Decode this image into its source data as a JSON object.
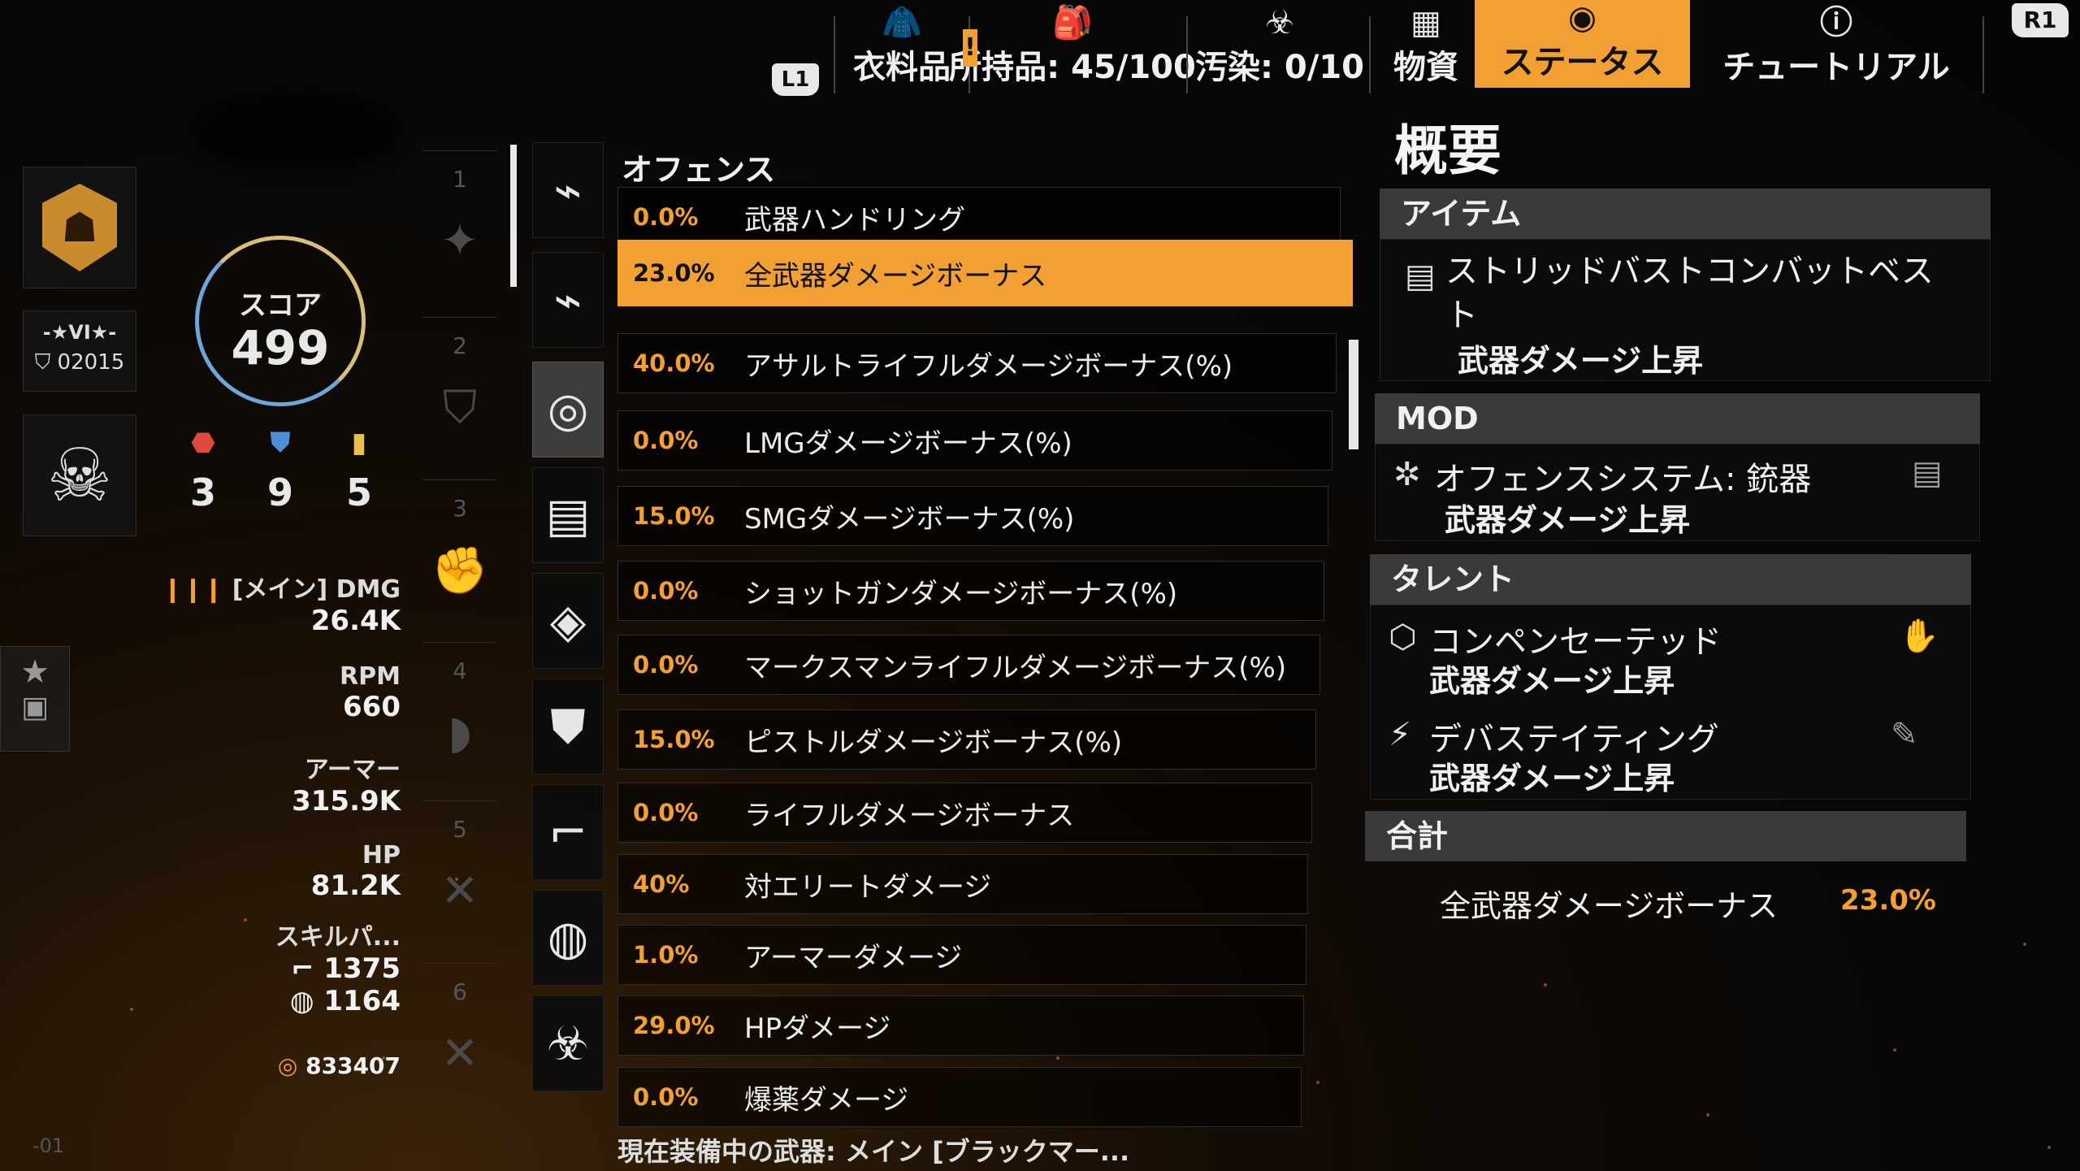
{
  "topbar": {
    "l1": "L1",
    "r1": "R1",
    "warning": "!",
    "apparel_label": "衣料品",
    "inventory_label": "所持品: 45/100",
    "contamination_label": "汚染: 0/10",
    "resources_label": "物資",
    "status_label": "ステータス",
    "tutorial_label": "チュートリアル",
    "icons": {
      "apparel": "jacket-icon",
      "inventory": "backpack-icon",
      "contamination": "biohazard-icon",
      "resources": "crates-icon",
      "status": "target-icon",
      "tutorial": "info-icon"
    }
  },
  "player": {
    "rank_title": "-★VI★-",
    "rank_number": "02015",
    "score_label": "スコア",
    "score": "499",
    "cores": [
      {
        "name": "offense",
        "color": "#e04a3c",
        "value": "3"
      },
      {
        "name": "defense",
        "color": "#4a8fd8",
        "value": "9"
      },
      {
        "name": "skill",
        "color": "#e8c04a",
        "value": "5"
      }
    ]
  },
  "stats": {
    "weapon_dmg_label": "[メイン] DMG",
    "weapon_dmg_value": "26.4K",
    "rpm_label": "RPM",
    "rpm_value": "660",
    "armor_label": "アーマー",
    "armor_value": "315.9K",
    "hp_label": "HP",
    "hp_value": "81.2K",
    "skill_label": "スキルパ...",
    "skill_value_1": "1375",
    "skill_value_2": "1164",
    "credits": "833407"
  },
  "slots": [
    "1",
    "2",
    "3",
    "4",
    "5",
    "6"
  ],
  "offense": {
    "heading": "オフェンス",
    "rows": [
      {
        "pct": "0.0%",
        "label": "武器ハンドリング"
      },
      {
        "pct": "23.0%",
        "label": "全武器ダメージボーナス"
      },
      {
        "pct": "40.0%",
        "label": "アサルトライフルダメージボーナス(%)"
      },
      {
        "pct": "0.0%",
        "label": "LMGダメージボーナス(%)"
      },
      {
        "pct": "15.0%",
        "label": "SMGダメージボーナス(%)"
      },
      {
        "pct": "0.0%",
        "label": "ショットガンダメージボーナス(%)"
      },
      {
        "pct": "0.0%",
        "label": "マークスマンライフルダメージボーナス(%)"
      },
      {
        "pct": "15.0%",
        "label": "ピストルダメージボーナス(%)"
      },
      {
        "pct": "0.0%",
        "label": "ライフルダメージボーナス"
      },
      {
        "pct": "40%",
        "label": "対エリートダメージ"
      },
      {
        "pct": "1.0%",
        "label": "アーマーダメージ"
      },
      {
        "pct": "29.0%",
        "label": "HPダメージ"
      },
      {
        "pct": "0.0%",
        "label": "爆薬ダメージ"
      }
    ],
    "selected_index": 1,
    "footer": "現在装備中の武器: メイン [ブラックマー..."
  },
  "summary": {
    "title": "概要",
    "item_heading": "アイテム",
    "item_name": "ストリッドバストコンバットベスト",
    "item_effect": "武器ダメージ上昇",
    "mod_heading": "MOD",
    "mod_name": "オフェンスシステム: 銃器",
    "mod_effect": "武器ダメージ上昇",
    "talent_heading": "タレント",
    "talent1_name": "コンペンセーテッド",
    "talent1_effect": "武器ダメージ上昇",
    "talent2_name": "デバステイティング",
    "talent2_effect": "武器ダメージ上昇",
    "total_heading": "合計",
    "total_label": "全武器ダメージボーナス",
    "total_value": "23.0%"
  },
  "corner": "-01"
}
